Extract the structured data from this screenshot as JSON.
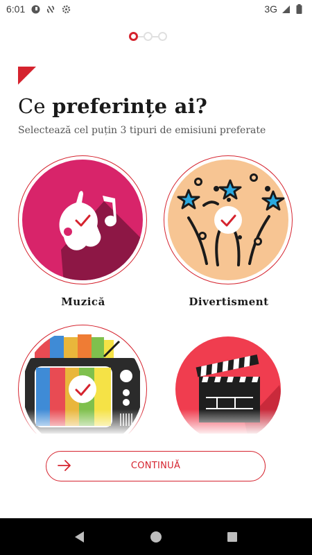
{
  "status_bar": {
    "time": "6:01",
    "network": "3G",
    "icons": [
      "media-notification-icon",
      "sync-off-icon",
      "settings-icon",
      "signal-icon",
      "battery-icon"
    ]
  },
  "onboarding": {
    "steps_total": 3,
    "current_step": 1
  },
  "header": {
    "title_prefix": "Ce ",
    "title_emphasis": "preferințe ai?",
    "subtitle": "Selectează cel puțin 3 tipuri de emisiuni preferate"
  },
  "categories": [
    {
      "label": "Muzică",
      "icon": "music-notes-icon",
      "selected": true,
      "color": "#d8246a"
    },
    {
      "label": "Divertisment",
      "icon": "fireworks-icon",
      "selected": true,
      "color": "#f7c593"
    },
    {
      "label": "",
      "icon": "retro-tv-icon",
      "selected": true,
      "color": "#2b2b2b"
    },
    {
      "label": "",
      "icon": "clapperboard-icon",
      "selected": false,
      "color": "#f03d4f"
    }
  ],
  "continue_button": {
    "label": "CONTINUĂ",
    "icon": "arrow-right-icon"
  },
  "colors": {
    "accent": "#d5232e",
    "text": "#1a1a1a",
    "nav_bar": "#000000"
  },
  "nav_bar": {
    "buttons": [
      "back-icon",
      "home-icon",
      "recents-icon"
    ]
  }
}
